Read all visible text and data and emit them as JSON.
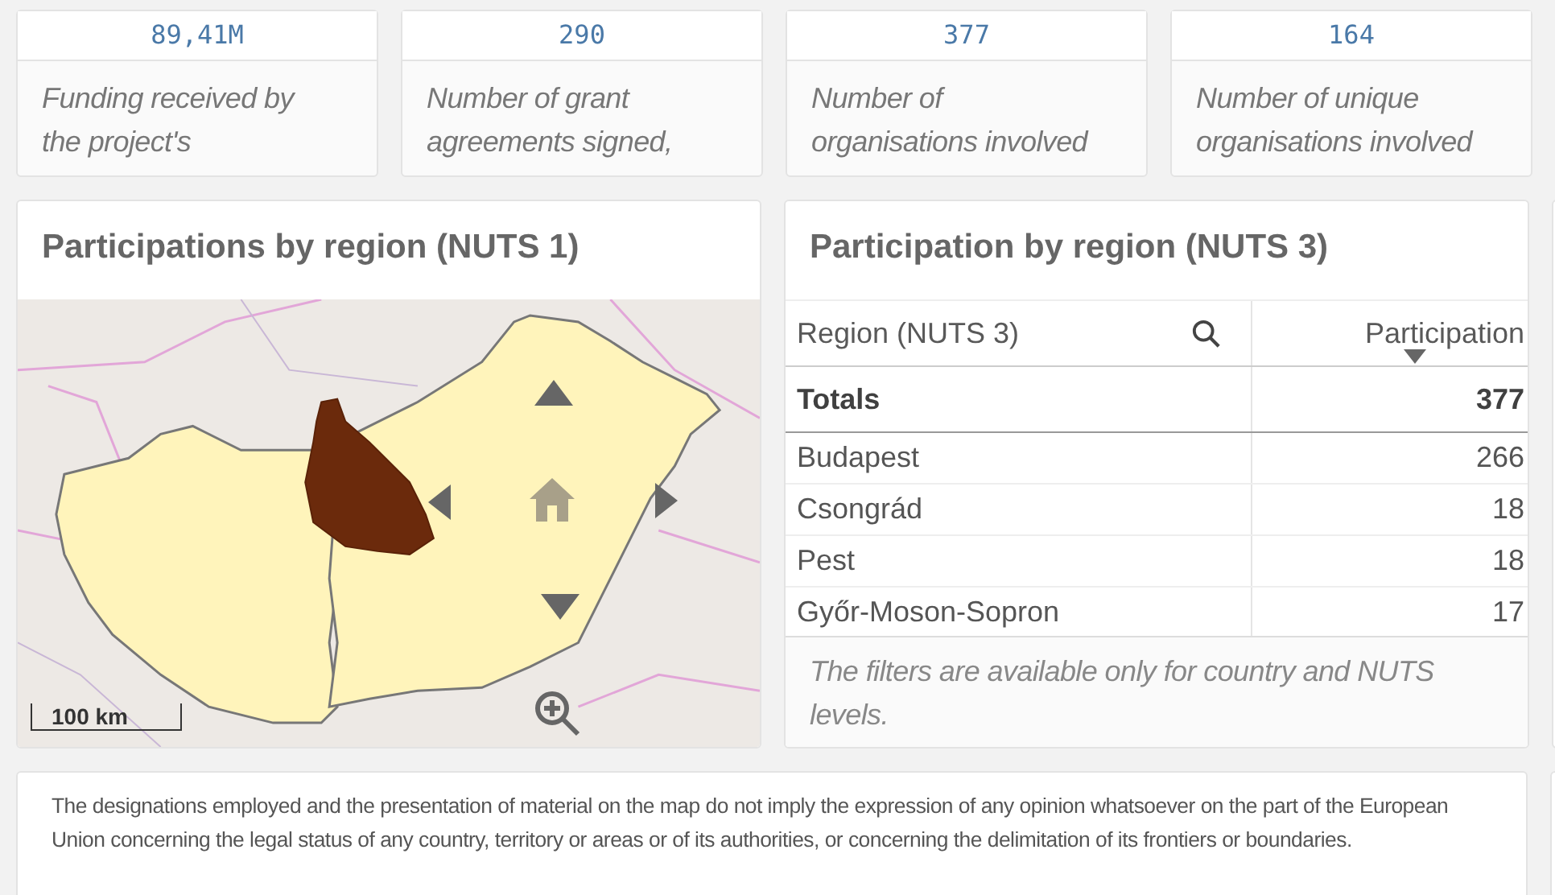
{
  "kpis": [
    {
      "value": "89,41M",
      "label": "Funding received by the project's"
    },
    {
      "value": "290",
      "label": "Number of grant agreements signed,"
    },
    {
      "value": "377",
      "label": "Number of organisations involved"
    },
    {
      "value": "164",
      "label": "Number of unique organisations involved"
    }
  ],
  "map": {
    "title": "Participations by region (NUTS 1)",
    "scale_label": "100 km"
  },
  "table": {
    "title": "Participation by region (NUTS 3)",
    "columns": [
      {
        "label": "Region (NUTS 3)",
        "searchable": true,
        "sorted": false
      },
      {
        "label": "Participation",
        "searchable": false,
        "sorted": true
      }
    ],
    "totals": {
      "label": "Totals",
      "value": "377"
    },
    "rows": [
      {
        "region": "Budapest",
        "value": "266"
      },
      {
        "region": "Csongrád",
        "value": "18"
      },
      {
        "region": "Pest",
        "value": "18"
      },
      {
        "region": "Győr-Moson-Sopron",
        "value": "17"
      }
    ],
    "footnote": "The filters are available only for country and NUTS levels."
  },
  "disclaimer": "The designations employed and the presentation of material on the map do not imply the expression of any opinion whatsoever on the part of the European Union concerning the legal status of any country, territory or areas or of its authorities, or concerning the delimitation of its frontiers or boundaries."
}
